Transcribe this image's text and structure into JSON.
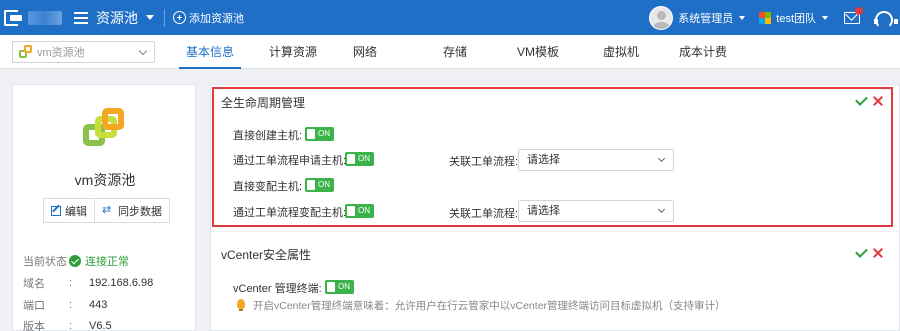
{
  "header": {
    "title": "资源池",
    "add_pool": "添加资源池",
    "user": "系统管理员",
    "team": "test团队"
  },
  "toolbar": {
    "pool_select_value": "vm资源池",
    "tabs": [
      "基本信息",
      "计算资源",
      "网络",
      "存储",
      "VM模板",
      "虚拟机",
      "成本计费"
    ],
    "active_tab": "基本信息"
  },
  "sidebar": {
    "pool_name": "vm资源池",
    "edit_label": "编辑",
    "sync_label": "同步数据",
    "info": [
      {
        "key": "当前状态",
        "value": "连接正常"
      },
      {
        "key": "域名",
        "value": "192.168.6.98"
      },
      {
        "key": "端口",
        "value": "443"
      },
      {
        "key": "版本",
        "value": "V6.5"
      }
    ],
    "colon": ":"
  },
  "lifecycle": {
    "title": "全生命周期管理",
    "rows": [
      {
        "label": "直接创建主机:",
        "toggle": "ON"
      },
      {
        "label": "通过工单流程申请主机:",
        "toggle": "ON",
        "flow_label": "关联工单流程:",
        "flow_value": "请选择"
      },
      {
        "label": "直接变配主机:",
        "toggle": "ON"
      },
      {
        "label": "通过工单流程变配主机:",
        "toggle": "ON",
        "flow_label": "关联工单流程:",
        "flow_value": "请选择"
      }
    ]
  },
  "vcenter": {
    "title": "vCenter安全属性",
    "terminal_label": "vCenter 管理终端:",
    "toggle": "ON",
    "hint": "开启vCenter管理终端意味着：允许用户在行云管家中以vCenter管理终端访问目标虚拟机（支持审计）"
  },
  "colors": {
    "brand": "#1f6fc7",
    "toggle_on": "#3cb34a",
    "highlight_border": "#e03c40",
    "ok": "#2e9d3a"
  }
}
